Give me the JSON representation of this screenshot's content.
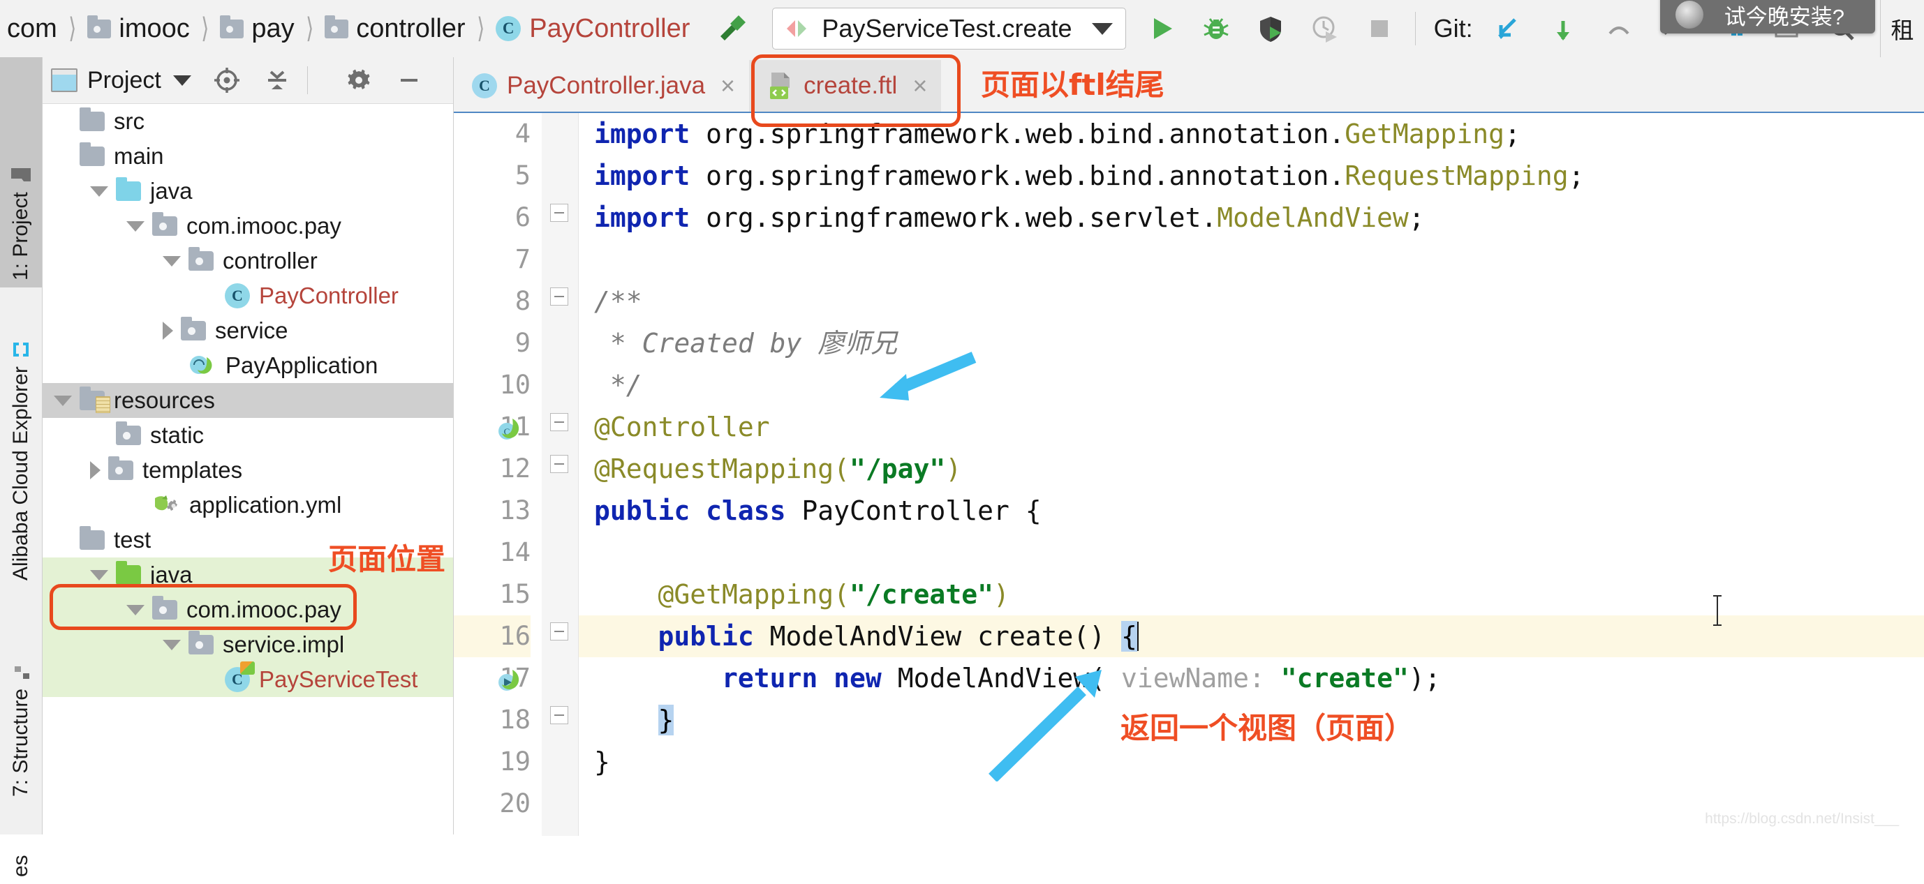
{
  "breadcrumb": [
    {
      "label": "com",
      "icon": "none"
    },
    {
      "label": "imooc",
      "icon": "folder-icon"
    },
    {
      "label": "pay",
      "icon": "folder-icon"
    },
    {
      "label": "controller",
      "icon": "folder-icon"
    },
    {
      "label": "PayController",
      "icon": "java-class-icon"
    }
  ],
  "toolbar": {
    "build_icon": "hammer-icon",
    "run_config": {
      "label": "PayServiceTest.create",
      "icon": "run-config-icon",
      "dropdown": "chevron-down-icon"
    },
    "run_button": "run-icon",
    "debug_button": "debug-bug-icon",
    "run_coverage_button": "run-with-coverage-icon",
    "profiler_button": "profiler-icon",
    "stop_button": "stop-icon",
    "git_label": "Git:",
    "git_update_icon": "git-update-project-icon",
    "git_commit_icon": "git-commit-icon",
    "git_push_icon": "git-push-icon",
    "search_icon": "search-icon"
  },
  "notification": {
    "text": "试今晚安装?",
    "icon": "ide-update-icon",
    "edge_label": "租"
  },
  "tool_windows": [
    {
      "label": "1: Project",
      "icon": "project-folder-icon",
      "selected": true
    },
    {
      "label": "Alibaba Cloud Explorer",
      "icon": "alibaba-cloud-icon",
      "selected": false
    },
    {
      "label": "7: Structure",
      "icon": "structure-icon",
      "selected": false
    },
    {
      "label": "es",
      "icon": "favorites-icon",
      "selected": false
    }
  ],
  "project_panel": {
    "title": "Project",
    "title_caret": "chevron-down-icon",
    "locate_icon": "scroll-from-source-icon",
    "collapse_icon": "collapse-all-icon",
    "settings_icon": "gear-icon",
    "hide_icon": "minimize-icon",
    "tree": [
      {
        "label": "src",
        "indent": 0,
        "arrow": "none",
        "icon": "folder-plain",
        "style": "normal",
        "highlight": "none"
      },
      {
        "label": "main",
        "indent": 0,
        "arrow": "none",
        "icon": "folder-plain",
        "style": "normal",
        "highlight": "none"
      },
      {
        "label": "java",
        "indent": 1,
        "arrow": "down",
        "icon": "folder-source",
        "style": "normal",
        "highlight": "none"
      },
      {
        "label": "com.imooc.pay",
        "indent": 2,
        "arrow": "down",
        "icon": "folder-package",
        "style": "normal",
        "highlight": "none"
      },
      {
        "label": "controller",
        "indent": 3,
        "arrow": "down",
        "icon": "folder-package",
        "style": "normal",
        "highlight": "none"
      },
      {
        "label": "PayController",
        "indent": 4,
        "arrow": "none",
        "icon": "java-class",
        "style": "red",
        "highlight": "none"
      },
      {
        "label": "service",
        "indent": 3,
        "arrow": "right",
        "icon": "folder-package",
        "style": "normal",
        "highlight": "none"
      },
      {
        "label": "PayApplication",
        "indent": 3,
        "arrow": "none",
        "icon": "spring-class",
        "style": "normal",
        "highlight": "none"
      },
      {
        "label": "resources",
        "indent": 0,
        "arrow": "down",
        "icon": "folder-resource",
        "style": "normal",
        "highlight": "gray"
      },
      {
        "label": "static",
        "indent": 1,
        "arrow": "none",
        "icon": "folder-package",
        "style": "normal",
        "highlight": "none"
      },
      {
        "label": "templates",
        "indent": 1,
        "arrow": "right",
        "icon": "folder-package",
        "style": "normal",
        "highlight": "none"
      },
      {
        "label": "application.yml",
        "indent": 2,
        "arrow": "none",
        "icon": "yml-file",
        "style": "normal",
        "highlight": "none"
      },
      {
        "label": "test",
        "indent": 0,
        "arrow": "none",
        "icon": "folder-plain",
        "style": "normal",
        "highlight": "none"
      },
      {
        "label": "java",
        "indent": 1,
        "arrow": "down",
        "icon": "folder-test",
        "style": "normal",
        "highlight": "green"
      },
      {
        "label": "com.imooc.pay",
        "indent": 2,
        "arrow": "down",
        "icon": "folder-package",
        "style": "normal",
        "highlight": "green"
      },
      {
        "label": "service.impl",
        "indent": 3,
        "arrow": "down",
        "icon": "folder-package",
        "style": "normal",
        "highlight": "green"
      },
      {
        "label": "PayServiceTest",
        "indent": 4,
        "arrow": "none",
        "icon": "test-class",
        "style": "red",
        "highlight": "green"
      }
    ]
  },
  "editor": {
    "tabs": [
      {
        "label": "PayController.java",
        "icon": "java-class-icon",
        "active": false,
        "close": "×"
      },
      {
        "label": "create.ftl",
        "icon": "ftl-file-icon",
        "active": true,
        "close": "×"
      }
    ],
    "lines": [
      {
        "num": "4",
        "segments": [
          {
            "t": "import ",
            "c": "kw"
          },
          {
            "t": "org.springframework.web.bind.annotation.",
            "c": "plain"
          },
          {
            "t": "GetMapping",
            "c": "ann"
          },
          {
            "t": ";",
            "c": "plain"
          }
        ],
        "current": false,
        "clipped": true
      },
      {
        "num": "5",
        "segments": [
          {
            "t": "import ",
            "c": "kw"
          },
          {
            "t": "org.springframework.web.bind.annotation.",
            "c": "plain"
          },
          {
            "t": "RequestMapping",
            "c": "ann"
          },
          {
            "t": ";",
            "c": "plain"
          }
        ],
        "current": false
      },
      {
        "num": "6",
        "segments": [
          {
            "t": "import ",
            "c": "kw"
          },
          {
            "t": "org.springframework.web.servlet.",
            "c": "plain"
          },
          {
            "t": "ModelAndView",
            "c": "ann"
          },
          {
            "t": ";",
            "c": "plain"
          }
        ],
        "current": false
      },
      {
        "num": "7",
        "segments": [],
        "current": false
      },
      {
        "num": "8",
        "segments": [
          {
            "t": "/**",
            "c": "cmt"
          }
        ],
        "current": false
      },
      {
        "num": "9",
        "segments": [
          {
            "t": " * Created by 廖师兄",
            "c": "cmt"
          }
        ],
        "current": false
      },
      {
        "num": "10",
        "segments": [
          {
            "t": " */",
            "c": "cmt"
          }
        ],
        "current": false
      },
      {
        "num": "11",
        "segments": [
          {
            "t": "@Controller",
            "c": "ann"
          }
        ],
        "current": false
      },
      {
        "num": "12",
        "segments": [
          {
            "t": "@RequestMapping(",
            "c": "ann"
          },
          {
            "t": "\"/pay\"",
            "c": "str"
          },
          {
            "t": ")",
            "c": "ann"
          }
        ],
        "current": false
      },
      {
        "num": "13",
        "segments": [
          {
            "t": "public class ",
            "c": "kw"
          },
          {
            "t": "PayController {",
            "c": "plain"
          }
        ],
        "current": false
      },
      {
        "num": "14",
        "segments": [],
        "current": false
      },
      {
        "num": "15",
        "segments": [
          {
            "t": "    @GetMapping(",
            "c": "ann"
          },
          {
            "t": "\"/create\"",
            "c": "str"
          },
          {
            "t": ")",
            "c": "ann"
          }
        ],
        "current": false
      },
      {
        "num": "16",
        "segments": [
          {
            "t": "    ",
            "c": "plain"
          },
          {
            "t": "public ",
            "c": "kw"
          },
          {
            "t": "ModelAndView create() ",
            "c": "plain"
          },
          {
            "t": "{",
            "c": "sel"
          }
        ],
        "current": true
      },
      {
        "num": "17",
        "segments": [
          {
            "t": "        ",
            "c": "plain"
          },
          {
            "t": "return new ",
            "c": "kw"
          },
          {
            "t": "ModelAndView( ",
            "c": "plain"
          },
          {
            "t": "viewName:",
            "c": "hint"
          },
          {
            "t": " ",
            "c": "plain"
          },
          {
            "t": "\"create\"",
            "c": "str"
          },
          {
            "t": ");",
            "c": "plain"
          }
        ],
        "current": false
      },
      {
        "num": "18",
        "segments": [
          {
            "t": "    ",
            "c": "plain"
          },
          {
            "t": "}",
            "c": "sel"
          }
        ],
        "current": false
      },
      {
        "num": "19",
        "segments": [
          {
            "t": "}",
            "c": "plain"
          }
        ],
        "current": false
      },
      {
        "num": "20",
        "segments": [],
        "current": false
      }
    ]
  },
  "annotations": [
    {
      "id": "anno-templates",
      "text": "页面位置",
      "color": "#ef4e24",
      "kind": "box-and-label"
    },
    {
      "id": "anno-ftl-tab",
      "text": "页面以ftl结尾",
      "color": "#ef4e24",
      "kind": "box-and-label"
    },
    {
      "id": "anno-controller",
      "text": "",
      "color": "#40bdf0",
      "kind": "arrow"
    },
    {
      "id": "anno-return",
      "text": "返回一个视图（页面）",
      "color": "#ef4e24",
      "kind": "arrow-and-label"
    }
  ],
  "watermark": "https://blog.csdn.net/Insist___"
}
